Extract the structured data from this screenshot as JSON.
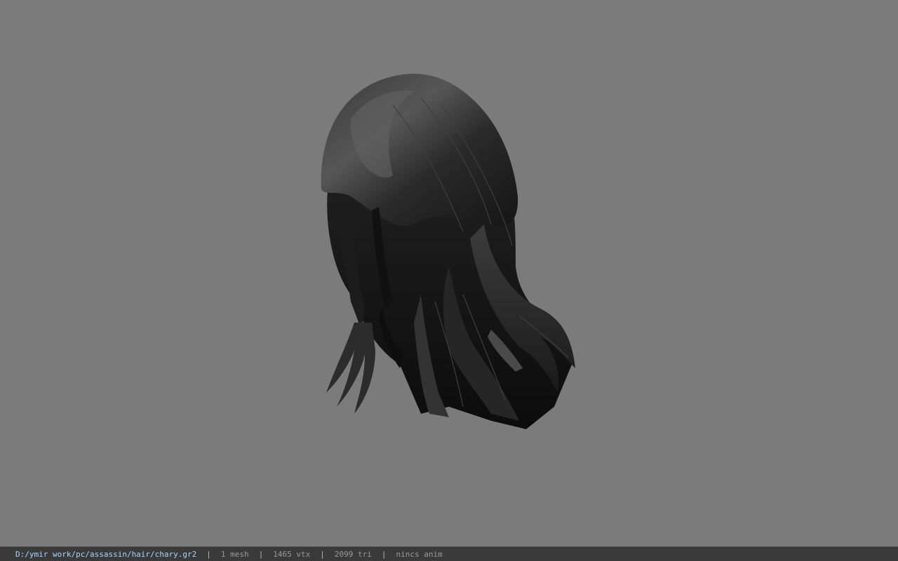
{
  "viewport": {
    "background_color": "#7b7b7b",
    "model_name": "hair mesh"
  },
  "statusbar": {
    "file_path": "D:/ymir work/pc/assassin/hair/chary.gr2",
    "separator": "|",
    "mesh_count": "1 mesh",
    "vertex_count": "1465 vtx",
    "triangle_count": "2099 tri",
    "anim_status": "nincs anim",
    "path_color": "#a9d3ff",
    "text_color": "#9a9a9a"
  }
}
